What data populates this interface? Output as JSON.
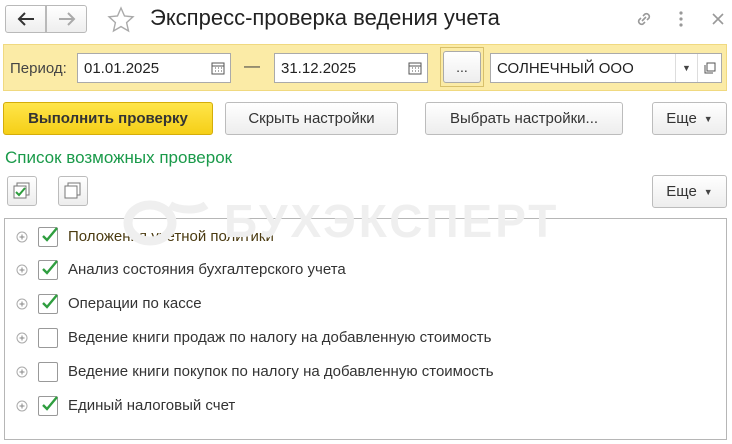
{
  "window": {
    "title": "Экспресс-проверка ведения учета",
    "back_icon": "arrow-left-icon",
    "forward_icon": "arrow-right-icon",
    "favorite_icon": "star-icon",
    "link_icon": "link-icon",
    "more_icon": "more-vertical-icon",
    "close_icon": "close-icon"
  },
  "filter": {
    "period_label": "Период:",
    "date_from": "01.01.2025",
    "separator": "—",
    "date_to": "31.12.2025",
    "period_button": "...",
    "organization": "СОЛНЕЧНЫЙ ООО"
  },
  "toolbar": {
    "run_check": "Выполнить проверку",
    "hide_settings": "Скрыть настройки",
    "choose_settings": "Выбрать настройки...",
    "more": "Еще"
  },
  "checks": {
    "section_title": "Список возможных проверок",
    "more": "Еще",
    "check_all_icon": "check-all-icon",
    "uncheck_all_icon": "uncheck-all-icon",
    "watermark": "БУХЭКСПЕРТ",
    "items": [
      {
        "label": "Положения учетной политики",
        "checked": true
      },
      {
        "label": "Анализ состояния бухгалтерского учета",
        "checked": true
      },
      {
        "label": "Операции по кассе",
        "checked": true
      },
      {
        "label": "Ведение книги продаж по налогу на добавленную стоимость",
        "checked": false
      },
      {
        "label": "Ведение книги покупок по налогу на добавленную стоимость",
        "checked": false
      },
      {
        "label": "Единый налоговый счет",
        "checked": true
      }
    ]
  },
  "colors": {
    "accent_green": "#1a9a4a",
    "filter_bg": "#fbeba6",
    "primary_button": "#f5cf17",
    "check_green": "#2f9e3f"
  }
}
